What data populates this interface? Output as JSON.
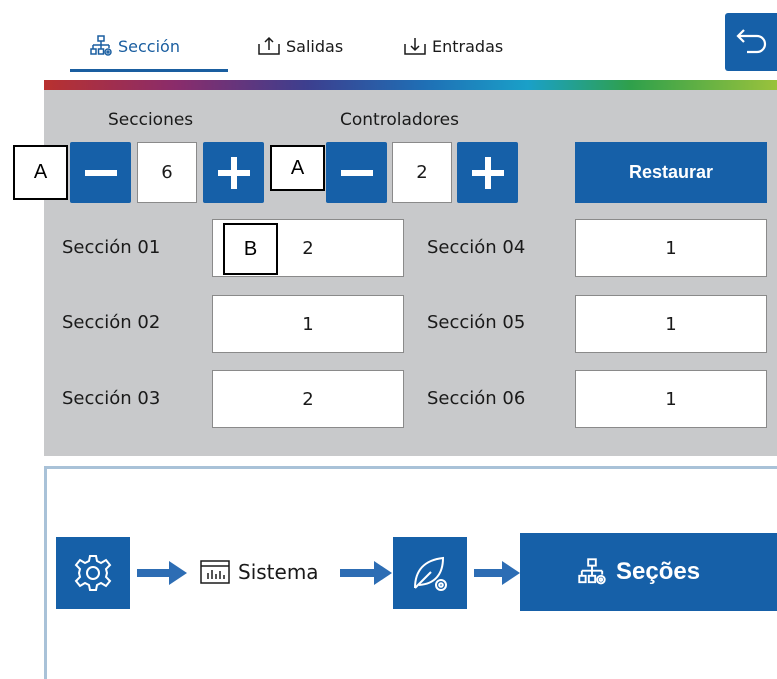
{
  "tabs": [
    {
      "label": "Sección",
      "icon": "section-tree-icon",
      "active": true
    },
    {
      "label": "Salidas",
      "icon": "upload-icon",
      "active": false
    },
    {
      "label": "Entradas",
      "icon": "download-icon",
      "active": false
    }
  ],
  "header": {
    "back_icon": "back-arrow-icon"
  },
  "controls": {
    "secciones_label": "Secciones",
    "secciones_value": "6",
    "controladores_label": "Controladores",
    "controladores_value": "2",
    "restaurar_label": "Restaurar"
  },
  "sections": [
    {
      "label": "Sección 01",
      "value": "2"
    },
    {
      "label": "Sección 02",
      "value": "1"
    },
    {
      "label": "Sección 03",
      "value": "2"
    },
    {
      "label": "Sección 04",
      "value": "1"
    },
    {
      "label": "Sección 05",
      "value": "1"
    },
    {
      "label": "Sección 06",
      "value": "1"
    }
  ],
  "callouts": {
    "a": "A",
    "b": "B"
  },
  "breadcrumb": {
    "sistema_label": "Sistema",
    "secoes_label": "Seções"
  },
  "colors": {
    "accent": "#1660a8",
    "panel": "#c8c9cb",
    "arrow": "#2d6db4"
  }
}
